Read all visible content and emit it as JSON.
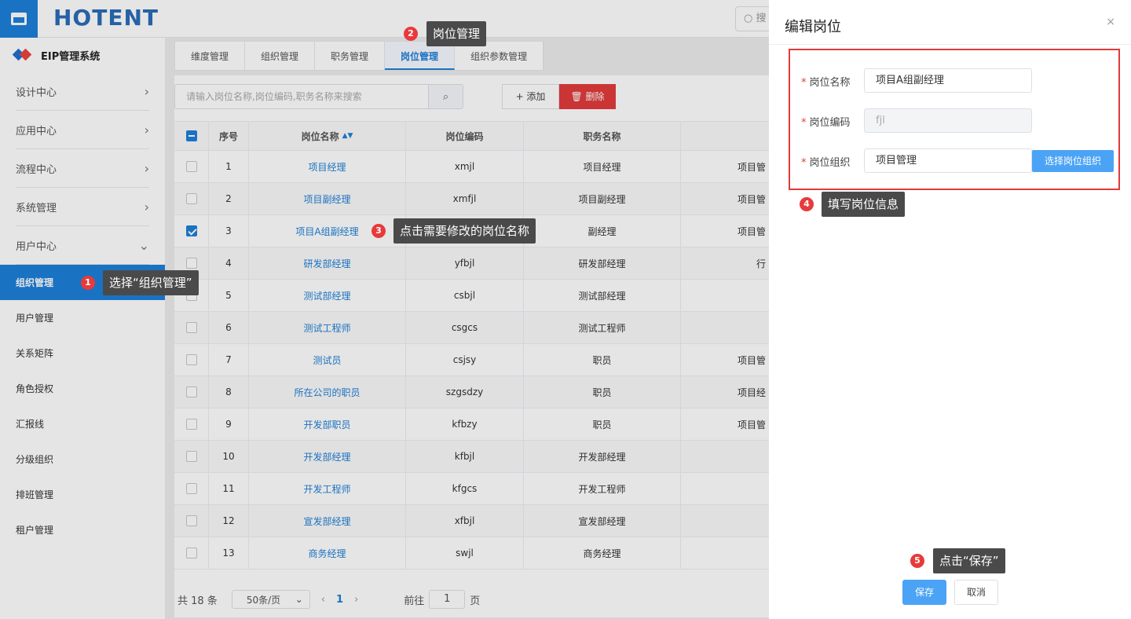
{
  "header": {
    "logo_text": "HOTENT",
    "search_placeholder": "搜"
  },
  "sidebar": {
    "system_title": "EIP管理系统",
    "groups": [
      "设计中心",
      "应用中心",
      "流程中心",
      "系统管理",
      "用户中心"
    ],
    "active_item": "组织管理",
    "items": [
      "用户管理",
      "关系矩阵",
      "角色授权",
      "汇报线",
      "分级组织",
      "排班管理",
      "租户管理"
    ]
  },
  "tabs": [
    "维度管理",
    "组织管理",
    "职务管理",
    "岗位管理",
    "组织参数管理"
  ],
  "active_tab": 3,
  "toolbar": {
    "search_placeholder": "请输入岗位名称,岗位编码,职务名称来搜索",
    "add_label": "+ 添加",
    "delete_label": "删除"
  },
  "table": {
    "headers": [
      "序号",
      "岗位名称",
      "岗位编码",
      "职务名称"
    ],
    "rows": [
      {
        "no": "1",
        "name": "项目经理",
        "code": "xmjl",
        "job": "项目经理",
        "org": "项目管",
        "checked": false
      },
      {
        "no": "2",
        "name": "项目副经理",
        "code": "xmfjl",
        "job": "项目副经理",
        "org": "项目管",
        "checked": false
      },
      {
        "no": "3",
        "name": "项目A组副经理",
        "code": "fjl",
        "job": "副经理",
        "org": "项目管",
        "checked": true
      },
      {
        "no": "4",
        "name": "研发部经理",
        "code": "yfbjl",
        "job": "研发部经理",
        "org": "行",
        "checked": false
      },
      {
        "no": "5",
        "name": "测试部经理",
        "code": "csbjl",
        "job": "测试部经理",
        "org": "",
        "checked": false
      },
      {
        "no": "6",
        "name": "测试工程师",
        "code": "csgcs",
        "job": "测试工程师",
        "org": "",
        "checked": false
      },
      {
        "no": "7",
        "name": "测试员",
        "code": "csjsy",
        "job": "职员",
        "org": "项目管",
        "checked": false
      },
      {
        "no": "8",
        "name": "所在公司的职员",
        "code": "szgsdzy",
        "job": "职员",
        "org": "项目经",
        "checked": false
      },
      {
        "no": "9",
        "name": "开发部职员",
        "code": "kfbzy",
        "job": "职员",
        "org": "项目管",
        "checked": false
      },
      {
        "no": "10",
        "name": "开发部经理",
        "code": "kfbjl",
        "job": "开发部经理",
        "org": "",
        "checked": false
      },
      {
        "no": "11",
        "name": "开发工程师",
        "code": "kfgcs",
        "job": "开发工程师",
        "org": "",
        "checked": false
      },
      {
        "no": "12",
        "name": "宣发部经理",
        "code": "xfbjl",
        "job": "宣发部经理",
        "org": "",
        "checked": false
      },
      {
        "no": "13",
        "name": "商务经理",
        "code": "swjl",
        "job": "商务经理",
        "org": "",
        "checked": false
      }
    ]
  },
  "pagination": {
    "total": "共 18 条",
    "page_size": "50条/页",
    "current": "1",
    "goto_label": "前往",
    "goto_value": "1",
    "page_suffix": "页"
  },
  "drawer": {
    "title": "编辑岗位",
    "close": "×",
    "fields": [
      {
        "label": "岗位名称",
        "value": "项目A组副经理"
      },
      {
        "label": "岗位编码",
        "value": "fjl"
      },
      {
        "label": "岗位组织",
        "value": "项目管理"
      }
    ],
    "choose_org_label": "选择岗位组织",
    "save_label": "保存",
    "cancel_label": "取消"
  },
  "callouts": [
    {
      "num": "1",
      "text": "选择“组织管理”"
    },
    {
      "num": "2",
      "text": "岗位管理"
    },
    {
      "num": "3",
      "text": "点击需要修改的岗位名称"
    },
    {
      "num": "4",
      "text": "填写岗位信息"
    },
    {
      "num": "5",
      "text": "点击“保存”"
    }
  ],
  "colors": {
    "primary": "#1e7fd8",
    "danger": "#e23b3b",
    "accent_button": "#4ba3f5"
  }
}
